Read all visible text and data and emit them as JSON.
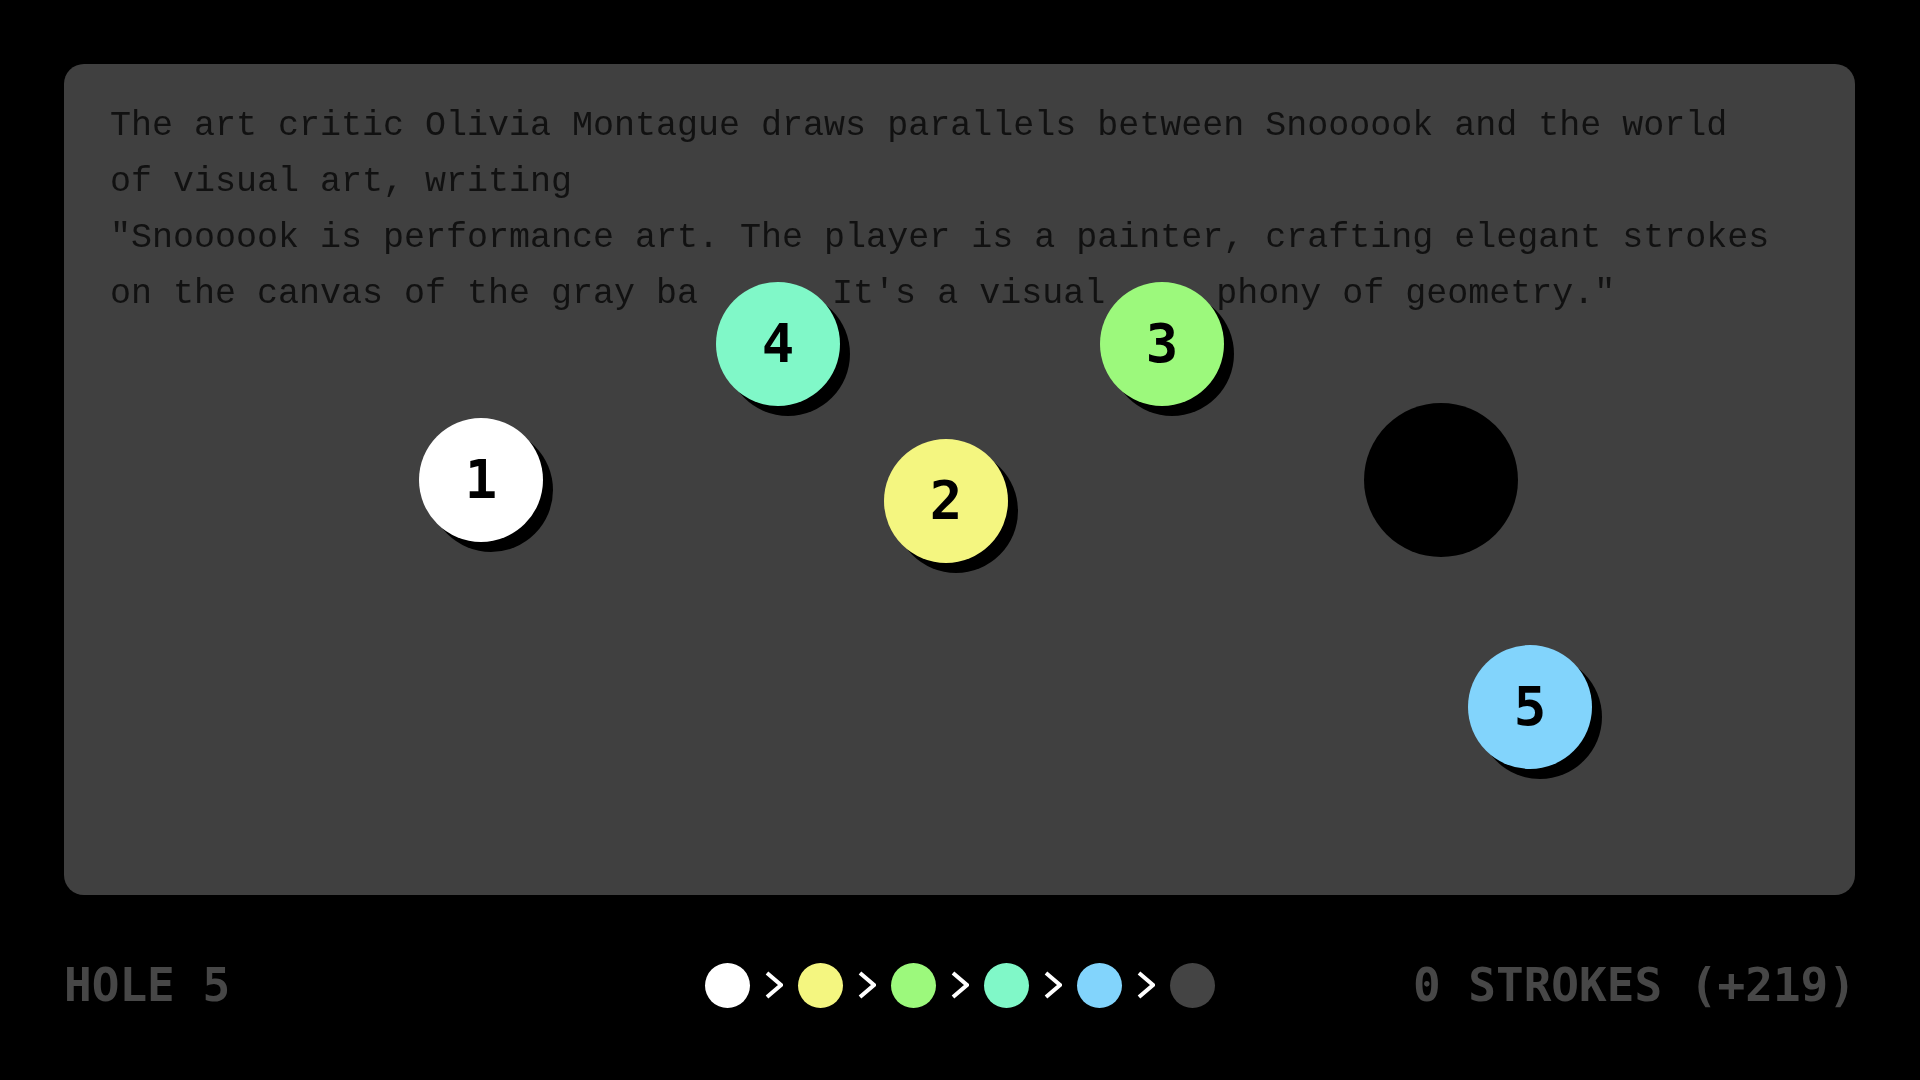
{
  "passage": {
    "intro": "The art critic Olivia Montague draws parallels between Snoooook and the world of visual art, writing",
    "quote_lines": [
      {
        "fragments": [
          "\"Snoooook is performance art. The player is a painter, crafting elegant strokes"
        ]
      },
      {
        "fragments": [
          "on the canvas of the gray ba",
          "It's a visual",
          "phony of geometry.\""
        ]
      }
    ]
  },
  "course": {
    "balls": [
      {
        "label": "1",
        "color": "#ffffff"
      },
      {
        "label": "2",
        "color": "#f4f680"
      },
      {
        "label": "3",
        "color": "#9cf97c"
      },
      {
        "label": "4",
        "color": "#80f8c8"
      },
      {
        "label": "5",
        "color": "#82d4fc"
      }
    ]
  },
  "status_bar": {
    "hole": "HOLE 5",
    "sequence": [
      {
        "color": "#ffffff"
      },
      {
        "color": "#f4f680"
      },
      {
        "color": "#9cf97c"
      },
      {
        "color": "#80f8c8"
      },
      {
        "color": "#82d4fc"
      },
      {
        "color": "#444444"
      }
    ],
    "strokes": "0 STROKES (+219)"
  }
}
